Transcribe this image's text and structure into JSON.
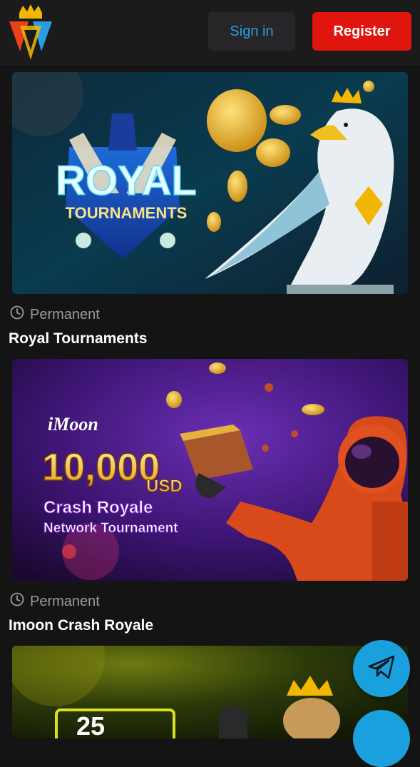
{
  "header": {
    "logo_alt": "KBS crown logo",
    "signin_label": "Sign in",
    "register_label": "Register"
  },
  "colors": {
    "accent_blue": "#2a9de0",
    "register_red": "#e0160e",
    "background": "#141414"
  },
  "promotions": [
    {
      "banner_text_line1": "ROYAL",
      "banner_text_line2": "TOURNAMENTS",
      "status_icon": "clock-icon",
      "status": "Permanent",
      "title": "Royal Tournaments"
    },
    {
      "banner_brand": "iMoon",
      "banner_amount": "10,000",
      "banner_currency": "USD",
      "banner_line1": "Crash Royale",
      "banner_line2": "Network Tournament",
      "status_icon": "clock-icon",
      "status": "Permanent",
      "title": "Imoon Crash Royale"
    },
    {
      "banner_text": "25"
    }
  ],
  "floating": {
    "telegram_icon": "telegram-icon"
  }
}
